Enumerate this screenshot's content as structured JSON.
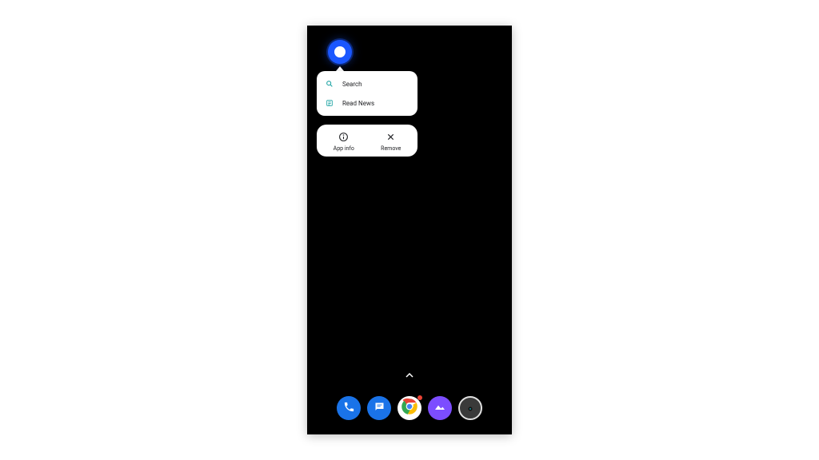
{
  "shortcuts": {
    "items": [
      {
        "label": "Search",
        "icon": "search-icon"
      },
      {
        "label": "Read News",
        "icon": "news-icon"
      }
    ]
  },
  "actions": {
    "app_info": "App info",
    "remove": "Remove"
  },
  "dock": {
    "items": [
      {
        "name": "phone-icon"
      },
      {
        "name": "messages-icon"
      },
      {
        "name": "chrome-icon"
      },
      {
        "name": "photos-icon"
      },
      {
        "name": "camera-icon"
      }
    ]
  }
}
